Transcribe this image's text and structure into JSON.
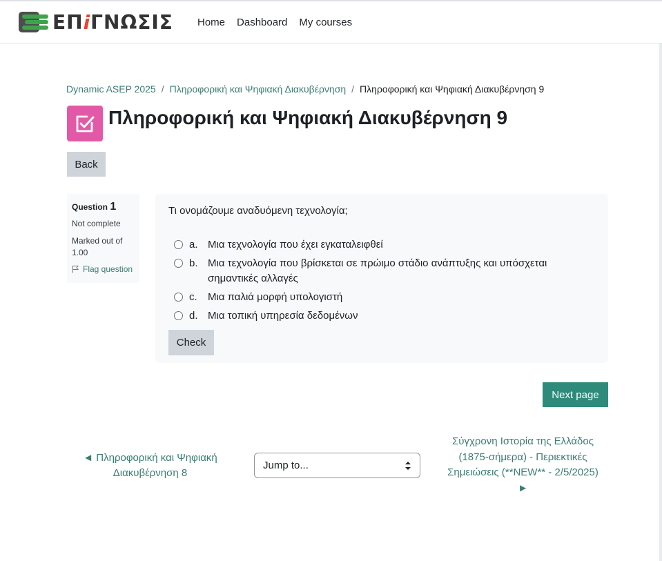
{
  "brand": {
    "logo_text_a": "ΕΠ",
    "logo_text_b": "i",
    "logo_text_c": "ΓΝΩΣΙΣ"
  },
  "nav": {
    "items": [
      "Home",
      "Dashboard",
      "My courses"
    ]
  },
  "breadcrumb": {
    "items": [
      "Dynamic ASEP 2025",
      "Πληροφορική και Ψηφιακή Διακυβέρνηση"
    ],
    "current": "Πληροφορική και Ψηφιακή Διακυβέρνηση 9",
    "separator": "/"
  },
  "page": {
    "title": "Πληροφορική και Ψηφιακή Διακυβέρνηση 9",
    "back_label": "Back"
  },
  "question": {
    "label": "Question",
    "number": "1",
    "state": "Not complete",
    "grade": "Marked out of 1.00",
    "flag_label": "Flag question",
    "text": "Τι ονομάζουμε αναδυόμενη τεχνολογία;",
    "answers": [
      {
        "letter": "a.",
        "text": "Μια τεχνολογία που έχει εγκαταλειφθεί"
      },
      {
        "letter": "b.",
        "text": "Μια τεχνολογία που βρίσκεται σε πρώιμο στάδιο ανάπτυξης και υπόσχεται σημαντικές αλλαγές"
      },
      {
        "letter": "c.",
        "text": "Μια παλιά μορφή υπολογιστή"
      },
      {
        "letter": "d.",
        "text": "Μια τοπική υπηρεσία δεδομένων"
      }
    ],
    "check_label": "Check"
  },
  "navigation": {
    "next_page_label": "Next page",
    "prev_activity": "◄ Πληροφορική και Ψηφιακή Διακυβέρνηση 8",
    "jump_label": "Jump to...",
    "next_activity": "Σύγχρονη Ιστορία της Ελλάδος (1875-σήμερα) - Περιεκτικές Σημειώσεις (**NEW** - 2/5/2025) ►"
  },
  "colors": {
    "accent": "#2e8a7a",
    "link": "#3a7d73",
    "quiz_icon": "#e25aa7"
  }
}
